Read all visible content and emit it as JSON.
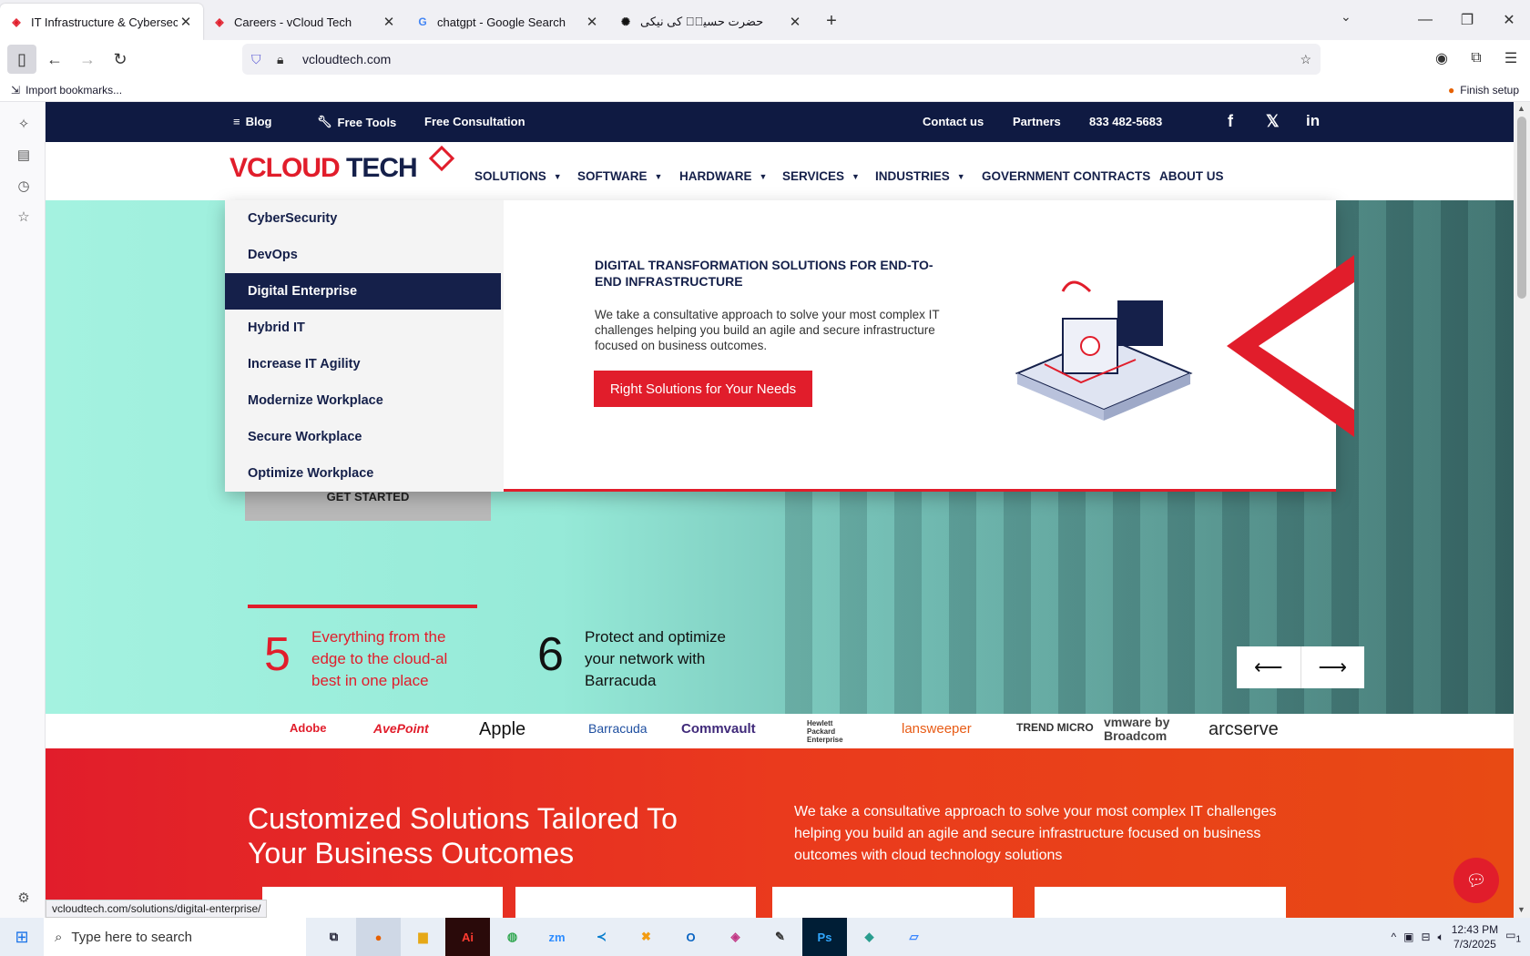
{
  "browser": {
    "tabs": [
      {
        "label": "IT Infrastructure & Cybersecurit",
        "active": true,
        "icon": "vcloud-favicon"
      },
      {
        "label": "Careers - vCloud Tech",
        "active": false,
        "icon": "vcloud-favicon"
      },
      {
        "label": "chatgpt - Google Search",
        "active": false,
        "icon": "google-icon"
      },
      {
        "label": "حضرت حسینؓ کی نیکی",
        "active": false,
        "icon": "chatgpt-icon"
      }
    ],
    "url": "vcloudtech.com",
    "bookmarks": {
      "import": "Import bookmarks...",
      "finish": "Finish setup"
    },
    "status_url": "vcloudtech.com/solutions/digital-enterprise/"
  },
  "site": {
    "topbar": {
      "blog": "Blog",
      "free_tools": "Free Tools",
      "free_consultation": "Free Consultation",
      "contact": "Contact us",
      "partners": "Partners",
      "phone": "833 482-5683"
    },
    "logo": {
      "v": "V",
      "cloud": "CLOUD",
      "tech": "TECH"
    },
    "nav": [
      {
        "label": "SOLUTIONS",
        "caret": true
      },
      {
        "label": "SOFTWARE",
        "caret": true
      },
      {
        "label": "HARDWARE",
        "caret": true
      },
      {
        "label": "SERVICES",
        "caret": true
      },
      {
        "label": "INDUSTRIES",
        "caret": true
      },
      {
        "label": "GOVERNMENT CONTRACTS",
        "caret": false
      },
      {
        "label": "ABOUT US",
        "caret": false
      }
    ],
    "dropdown": {
      "items": [
        "CyberSecurity",
        "DevOps",
        "Digital Enterprise",
        "Hybrid IT",
        "Increase IT Agility",
        "Modernize Workplace",
        "Secure Workplace",
        "Optimize Workplace"
      ],
      "selected_index": 2,
      "heading": "DIGITAL TRANSFORMATION SOLUTIONS FOR END-TO-END INFRASTRUCTURE",
      "text": "We take a consultative approach to solve your most complex IT challenges helping you build an agile and secure infrastructure focused on business outcomes.",
      "button": "Right Solutions for Your Needs"
    },
    "hero": {
      "get_started": "GET STARTED",
      "stats": [
        {
          "num": "5",
          "text": "Everything from the edge to the cloud-al best in one place"
        },
        {
          "num": "6",
          "text": "Protect and optimize your network with Barracuda"
        }
      ]
    },
    "partners_logos": [
      "Adobe",
      "AvePoint",
      "Apple",
      "Barracuda",
      "Commvault",
      "Hewlett Packard Enterprise",
      "lansweeper",
      "TREND MICRO",
      "vmware by Broadcom",
      "arcserve"
    ],
    "section": {
      "title": "Customized Solutions Tailored To Your Business Outcomes",
      "text": "We take a consultative approach to solve your most complex IT challenges helping you build an agile and secure infrastructure focused on business outcomes with cloud technology solutions"
    }
  },
  "taskbar": {
    "search_placeholder": "Type here to search",
    "time": "12:43 PM",
    "date": "7/3/2025",
    "notif": "1"
  },
  "colors": {
    "brand_red": "#e11d2b",
    "navy": "#15204a",
    "topband": "#0f1a42"
  }
}
